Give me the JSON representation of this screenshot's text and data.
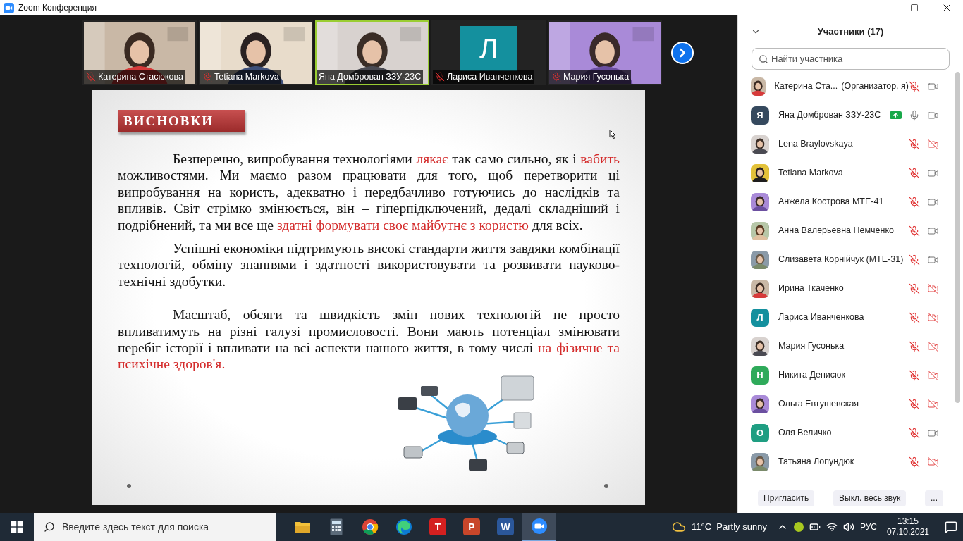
{
  "window": {
    "title": "Zoom Конференция"
  },
  "video_tiles": [
    {
      "name": "Катерина Стасюкова",
      "kind": "picture",
      "muted": true,
      "speaking": false
    },
    {
      "name": "Tetiana Markova",
      "kind": "picture",
      "muted": true,
      "speaking": false
    },
    {
      "name": "Яна Домброван ЗЗУ-23С",
      "kind": "picture",
      "muted": false,
      "speaking": true
    },
    {
      "name": "Лариса Иванченкова",
      "kind": "letter",
      "letter": "Л",
      "color": "#14909e",
      "muted": true,
      "speaking": false
    },
    {
      "name": "Мария Гусонька",
      "kind": "picture",
      "muted": true,
      "speaking": false
    }
  ],
  "slide": {
    "title": "ВИСНОВКИ",
    "paragraphs": [
      [
        {
          "text": "Безперечно, випробування технологіями ",
          "highlight": false
        },
        {
          "text": "лякає",
          "highlight": true
        },
        {
          "text": " так само сильно, як і ",
          "highlight": false
        },
        {
          "text": "вабить",
          "highlight": true
        },
        {
          "text": " можливостями. Ми маємо разом працювати для того, щоб перетворити ці випробування на користь, адекватно і передбачливо готуючись до наслідків та впливів. Світ стрімко змінюється, він – гіперпідключений, дедалі складніший і подрібнений, та ми все ще ",
          "highlight": false
        },
        {
          "text": "здатні формувати своє майбутнє з користю",
          "highlight": true
        },
        {
          "text": " для всіх.",
          "highlight": false
        }
      ],
      [
        {
          "text": "Успішні економіки підтримують високі стандарти життя завдяки комбінації технологій, обміну знаннями і здатності використовувати та розвивати науково-технічні здобутки.",
          "highlight": false
        }
      ],
      [
        {
          "text": "Масштаб, обсяги та швидкість змін нових технологій не просто впливатимуть на різні галузі промисловості. Вони мають потенціал змінювати перебіг історії і впливати на всі аспекти нашого життя, в тому числі ",
          "highlight": false
        },
        {
          "text": "на фізичне та психічне здоров'я.",
          "highlight": true
        }
      ]
    ]
  },
  "participants": {
    "title": "Участники (17)",
    "search_placeholder": "Найти участника",
    "rows": [
      {
        "name": "Катерина Ста...",
        "role": "(Организатор, я)",
        "kind": "picture",
        "sharing": false,
        "muted": true,
        "video": true
      },
      {
        "name": "Яна Домброван ЗЗУ-23С",
        "kind": "letter",
        "letter": "Я",
        "color": "#35495e",
        "sharing": true,
        "muted": false,
        "video": true
      },
      {
        "name": "Lena Braylovskaya",
        "kind": "picture",
        "sharing": false,
        "muted": true,
        "video": false
      },
      {
        "name": "Tetiana Markova",
        "kind": "picture",
        "sharing": false,
        "muted": true,
        "video": true
      },
      {
        "name": "Анжела Кострова МТЕ-41",
        "kind": "picture",
        "sharing": false,
        "muted": true,
        "video": true
      },
      {
        "name": "Анна Валерьевна  Немченко",
        "kind": "picture",
        "sharing": false,
        "muted": true,
        "video": true
      },
      {
        "name": "Єлизавета Корнійчук (МТЕ-31)",
        "kind": "picture",
        "sharing": false,
        "muted": true,
        "video": true
      },
      {
        "name": "Ирина Ткаченко",
        "kind": "picture",
        "sharing": false,
        "muted": true,
        "video": false
      },
      {
        "name": "Лариса Иванченкова",
        "kind": "letter",
        "letter": "Л",
        "color": "#14909e",
        "sharing": false,
        "muted": true,
        "video": false
      },
      {
        "name": "Мария Гусонька",
        "kind": "picture",
        "sharing": false,
        "muted": true,
        "video": false
      },
      {
        "name": "Никита Денисюк",
        "kind": "letter",
        "letter": "Н",
        "color": "#2eaa5a",
        "sharing": false,
        "muted": true,
        "video": false
      },
      {
        "name": "Ольга Евтушевская",
        "kind": "picture",
        "sharing": false,
        "muted": true,
        "video": false
      },
      {
        "name": "Оля Величко",
        "kind": "letter",
        "letter": "О",
        "color": "#1f9e82",
        "sharing": false,
        "muted": true,
        "video": true
      },
      {
        "name": "Татьяна Лопундюк",
        "kind": "picture",
        "sharing": false,
        "muted": true,
        "video": false
      }
    ],
    "buttons": [
      "Пригласить",
      "Выкл. весь звук",
      "..."
    ]
  },
  "taskbar": {
    "search_placeholder": "Введите здесь текст для поиска",
    "apps": [
      {
        "kind": "folder",
        "active": false
      },
      {
        "kind": "calculator",
        "active": false
      },
      {
        "kind": "chrome",
        "active": false
      },
      {
        "kind": "edge",
        "active": false
      },
      {
        "kind": "letter",
        "glyph": "T",
        "color": "#d42020",
        "active": false
      },
      {
        "kind": "letter",
        "glyph": "P",
        "color": "#c8462a",
        "active": false
      },
      {
        "kind": "letter",
        "glyph": "W",
        "color": "#2b579a",
        "active": false
      },
      {
        "kind": "camera",
        "active": true
      }
    ],
    "weather": "11°C  Partly sunny",
    "language": "РУС",
    "time": "13:15",
    "date": "07.10.2021"
  }
}
